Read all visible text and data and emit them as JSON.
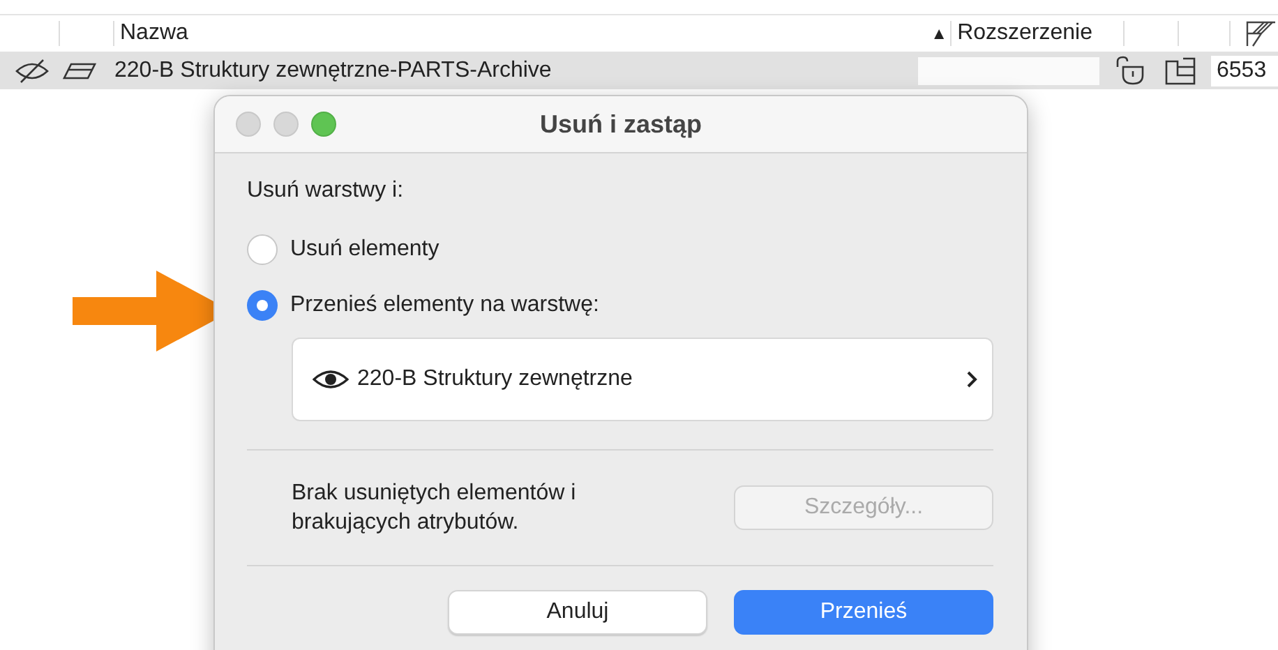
{
  "table": {
    "columns": [
      {
        "label": "Nazwa"
      },
      {
        "label": "Rozszerzenie",
        "sort_mark": "▲"
      }
    ],
    "rows": [
      {
        "name": "220-B Struktury zewnętrzne-PARTS-Archive",
        "number": "6553",
        "selected": true
      }
    ]
  },
  "dialog": {
    "title": "Usuń i zastąp",
    "prompt": "Usuń warstwy i:",
    "options": [
      {
        "label": "Usuń elementy",
        "selected": false
      },
      {
        "label": "Przenieś elementy na warstwę:",
        "selected": true
      }
    ],
    "layer": "220-B Struktury zewnętrzne",
    "info": "Brak usuniętych elementów i brakujących atrybutów.",
    "details_button": {
      "label": "Szczegóły...",
      "disabled": true
    },
    "buttons": [
      {
        "label": "Anuluj",
        "kind": "secondary"
      },
      {
        "label": "Przenieś",
        "kind": "primary"
      }
    ]
  }
}
